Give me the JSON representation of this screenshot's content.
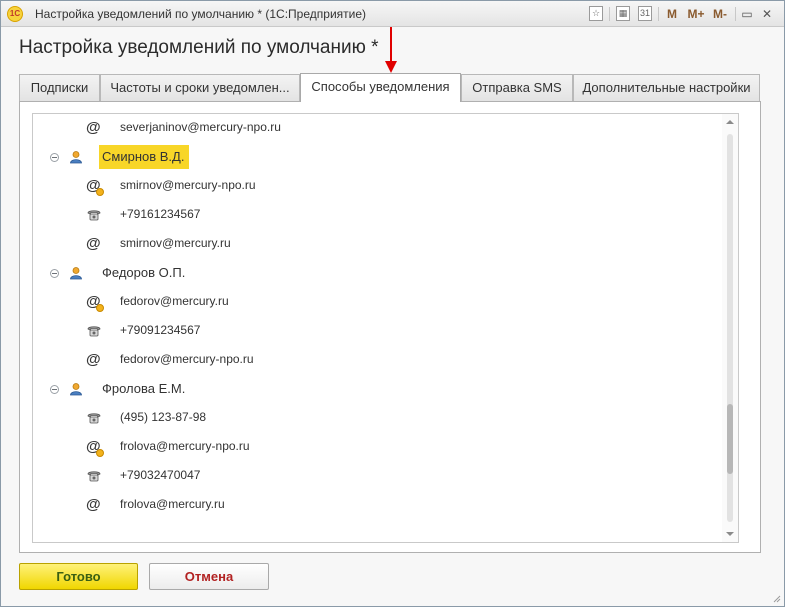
{
  "window": {
    "title": "Настройка уведомлений по умолчанию * (1С:Предприятие)",
    "logo_text": "1С",
    "controls": {
      "bookmark": "☆",
      "calculator": "▦",
      "calendar": "31",
      "m": "M",
      "m_plus": "M+",
      "m_minus": "M-",
      "minimize": "▭",
      "close": "✕"
    }
  },
  "heading": "Настройка уведомлений по умолчанию *",
  "tabs": [
    {
      "label": "Подписки"
    },
    {
      "label": "Частоты и сроки уведомлен..."
    },
    {
      "label": "Способы уведомления",
      "active": true
    },
    {
      "label": "Отправка SMS"
    },
    {
      "label": "Дополнительные настройки"
    }
  ],
  "tree": {
    "rows": [
      {
        "kind": "email",
        "text": "severjaninov@mercury-npo.ru"
      },
      {
        "kind": "person",
        "text": "Смирнов В.Д.",
        "selected": true
      },
      {
        "kind": "email-fav",
        "text": "smirnov@mercury-npo.ru"
      },
      {
        "kind": "phone",
        "text": "+79161234567"
      },
      {
        "kind": "email",
        "text": "smirnov@mercury.ru"
      },
      {
        "kind": "person",
        "text": "Федоров О.П."
      },
      {
        "kind": "email-fav",
        "text": "fedorov@mercury.ru"
      },
      {
        "kind": "phone",
        "text": "+79091234567"
      },
      {
        "kind": "email",
        "text": "fedorov@mercury-npo.ru"
      },
      {
        "kind": "person",
        "text": "Фролова Е.М."
      },
      {
        "kind": "phone",
        "text": "(495) 123-87-98"
      },
      {
        "kind": "email-fav",
        "text": "frolova@mercury-npo.ru"
      },
      {
        "kind": "phone",
        "text": "+79032470047"
      },
      {
        "kind": "email",
        "text": "frolova@mercury.ru"
      }
    ],
    "scroll_position": 0.85
  },
  "buttons": {
    "ok": "Готово",
    "cancel": "Отмена"
  },
  "colors": {
    "selection": "#f8d628",
    "ok_button": "#f0d600",
    "cancel_text": "#b22222",
    "arrow": "#e00000"
  }
}
